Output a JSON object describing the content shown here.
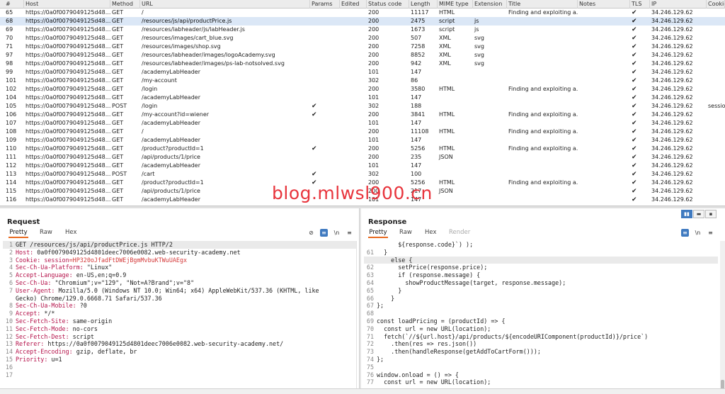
{
  "history": {
    "columns": {
      "num": "#",
      "host": "Host",
      "method": "Method",
      "url": "URL",
      "params": "Params",
      "edited": "Edited",
      "status": "Status code",
      "length": "Length",
      "mime": "MIME type",
      "ext": "Extension",
      "title": "Title",
      "notes": "Notes",
      "tls": "TLS",
      "ip": "IP",
      "cookie": "Cookie"
    },
    "selected_row": 1,
    "check_glyph": "✔",
    "rows": [
      {
        "num": "65",
        "host": "https://0a0f0079049125d48...",
        "method": "GET",
        "url": "/",
        "params": "",
        "edited": "",
        "status": "200",
        "length": "11117",
        "mime": "HTML",
        "ext": "",
        "title": "Finding and exploiting a...",
        "notes": "",
        "tls": "✔",
        "ip": "34.246.129.62",
        "cookie": ""
      },
      {
        "num": "68",
        "host": "https://0a0f0079049125d48...",
        "method": "GET",
        "url": "/resources/js/api/productPrice.js",
        "params": "",
        "edited": "",
        "status": "200",
        "length": "2475",
        "mime": "script",
        "ext": "js",
        "title": "",
        "notes": "",
        "tls": "✔",
        "ip": "34.246.129.62",
        "cookie": ""
      },
      {
        "num": "69",
        "host": "https://0a0f0079049125d48...",
        "method": "GET",
        "url": "/resources/labheader/js/labHeader.js",
        "params": "",
        "edited": "",
        "status": "200",
        "length": "1673",
        "mime": "script",
        "ext": "js",
        "title": "",
        "notes": "",
        "tls": "✔",
        "ip": "34.246.129.62",
        "cookie": ""
      },
      {
        "num": "70",
        "host": "https://0a0f0079049125d48...",
        "method": "GET",
        "url": "/resources/images/cart_blue.svg",
        "params": "",
        "edited": "",
        "status": "200",
        "length": "507",
        "mime": "XML",
        "ext": "svg",
        "title": "",
        "notes": "",
        "tls": "✔",
        "ip": "34.246.129.62",
        "cookie": ""
      },
      {
        "num": "71",
        "host": "https://0a0f0079049125d48...",
        "method": "GET",
        "url": "/resources/images/shop.svg",
        "params": "",
        "edited": "",
        "status": "200",
        "length": "7258",
        "mime": "XML",
        "ext": "svg",
        "title": "",
        "notes": "",
        "tls": "✔",
        "ip": "34.246.129.62",
        "cookie": ""
      },
      {
        "num": "97",
        "host": "https://0a0f0079049125d48...",
        "method": "GET",
        "url": "/resources/labheader/images/logoAcademy.svg",
        "params": "",
        "edited": "",
        "status": "200",
        "length": "8852",
        "mime": "XML",
        "ext": "svg",
        "title": "",
        "notes": "",
        "tls": "✔",
        "ip": "34.246.129.62",
        "cookie": ""
      },
      {
        "num": "98",
        "host": "https://0a0f0079049125d48...",
        "method": "GET",
        "url": "/resources/labheader/images/ps-lab-notsolved.svg",
        "params": "",
        "edited": "",
        "status": "200",
        "length": "942",
        "mime": "XML",
        "ext": "svg",
        "title": "",
        "notes": "",
        "tls": "✔",
        "ip": "34.246.129.62",
        "cookie": ""
      },
      {
        "num": "99",
        "host": "https://0a0f0079049125d48...",
        "method": "GET",
        "url": "/academyLabHeader",
        "params": "",
        "edited": "",
        "status": "101",
        "length": "147",
        "mime": "",
        "ext": "",
        "title": "",
        "notes": "",
        "tls": "✔",
        "ip": "34.246.129.62",
        "cookie": ""
      },
      {
        "num": "101",
        "host": "https://0a0f0079049125d48...",
        "method": "GET",
        "url": "/my-account",
        "params": "",
        "edited": "",
        "status": "302",
        "length": "86",
        "mime": "",
        "ext": "",
        "title": "",
        "notes": "",
        "tls": "✔",
        "ip": "34.246.129.62",
        "cookie": ""
      },
      {
        "num": "102",
        "host": "https://0a0f0079049125d48...",
        "method": "GET",
        "url": "/login",
        "params": "",
        "edited": "",
        "status": "200",
        "length": "3580",
        "mime": "HTML",
        "ext": "",
        "title": "Finding and exploiting a...",
        "notes": "",
        "tls": "✔",
        "ip": "34.246.129.62",
        "cookie": ""
      },
      {
        "num": "104",
        "host": "https://0a0f0079049125d48...",
        "method": "GET",
        "url": "/academyLabHeader",
        "params": "",
        "edited": "",
        "status": "101",
        "length": "147",
        "mime": "",
        "ext": "",
        "title": "",
        "notes": "",
        "tls": "✔",
        "ip": "34.246.129.62",
        "cookie": ""
      },
      {
        "num": "105",
        "host": "https://0a0f0079049125d48...",
        "method": "POST",
        "url": "/login",
        "params": "✔",
        "edited": "",
        "status": "302",
        "length": "188",
        "mime": "",
        "ext": "",
        "title": "",
        "notes": "",
        "tls": "✔",
        "ip": "34.246.129.62",
        "cookie": "sessio"
      },
      {
        "num": "106",
        "host": "https://0a0f0079049125d48...",
        "method": "GET",
        "url": "/my-account?id=wiener",
        "params": "✔",
        "edited": "",
        "status": "200",
        "length": "3841",
        "mime": "HTML",
        "ext": "",
        "title": "Finding and exploiting a...",
        "notes": "",
        "tls": "✔",
        "ip": "34.246.129.62",
        "cookie": ""
      },
      {
        "num": "107",
        "host": "https://0a0f0079049125d48...",
        "method": "GET",
        "url": "/academyLabHeader",
        "params": "",
        "edited": "",
        "status": "101",
        "length": "147",
        "mime": "",
        "ext": "",
        "title": "",
        "notes": "",
        "tls": "✔",
        "ip": "34.246.129.62",
        "cookie": ""
      },
      {
        "num": "108",
        "host": "https://0a0f0079049125d48...",
        "method": "GET",
        "url": "/",
        "params": "",
        "edited": "",
        "status": "200",
        "length": "11108",
        "mime": "HTML",
        "ext": "",
        "title": "Finding and exploiting a...",
        "notes": "",
        "tls": "✔",
        "ip": "34.246.129.62",
        "cookie": ""
      },
      {
        "num": "109",
        "host": "https://0a0f0079049125d48...",
        "method": "GET",
        "url": "/academyLabHeader",
        "params": "",
        "edited": "",
        "status": "101",
        "length": "147",
        "mime": "",
        "ext": "",
        "title": "",
        "notes": "",
        "tls": "✔",
        "ip": "34.246.129.62",
        "cookie": ""
      },
      {
        "num": "110",
        "host": "https://0a0f0079049125d48...",
        "method": "GET",
        "url": "/product?productId=1",
        "params": "✔",
        "edited": "",
        "status": "200",
        "length": "5256",
        "mime": "HTML",
        "ext": "",
        "title": "Finding and exploiting a...",
        "notes": "",
        "tls": "✔",
        "ip": "34.246.129.62",
        "cookie": ""
      },
      {
        "num": "111",
        "host": "https://0a0f0079049125d48...",
        "method": "GET",
        "url": "/api/products/1/price",
        "params": "",
        "edited": "",
        "status": "200",
        "length": "235",
        "mime": "JSON",
        "ext": "",
        "title": "",
        "notes": "",
        "tls": "✔",
        "ip": "34.246.129.62",
        "cookie": ""
      },
      {
        "num": "112",
        "host": "https://0a0f0079049125d48...",
        "method": "GET",
        "url": "/academyLabHeader",
        "params": "",
        "edited": "",
        "status": "101",
        "length": "147",
        "mime": "",
        "ext": "",
        "title": "",
        "notes": "",
        "tls": "✔",
        "ip": "34.246.129.62",
        "cookie": ""
      },
      {
        "num": "113",
        "host": "https://0a0f0079049125d48...",
        "method": "POST",
        "url": "/cart",
        "params": "✔",
        "edited": "",
        "status": "302",
        "length": "100",
        "mime": "",
        "ext": "",
        "title": "",
        "notes": "",
        "tls": "✔",
        "ip": "34.246.129.62",
        "cookie": ""
      },
      {
        "num": "114",
        "host": "https://0a0f0079049125d48...",
        "method": "GET",
        "url": "/product?productId=1",
        "params": "✔",
        "edited": "",
        "status": "200",
        "length": "5256",
        "mime": "HTML",
        "ext": "",
        "title": "Finding and exploiting a...",
        "notes": "",
        "tls": "✔",
        "ip": "34.246.129.62",
        "cookie": ""
      },
      {
        "num": "115",
        "host": "https://0a0f0079049125d48...",
        "method": "GET",
        "url": "/api/products/1/price",
        "params": "",
        "edited": "",
        "status": "200",
        "length": "217",
        "mime": "JSON",
        "ext": "",
        "title": "",
        "notes": "",
        "tls": "✔",
        "ip": "34.246.129.62",
        "cookie": ""
      },
      {
        "num": "116",
        "host": "https://0a0f0079049125d48...",
        "method": "GET",
        "url": "/academyLabHeader",
        "params": "",
        "edited": "",
        "status": "101",
        "length": "147",
        "mime": "",
        "ext": "",
        "title": "",
        "notes": "",
        "tls": "✔",
        "ip": "34.246.129.62",
        "cookie": ""
      }
    ]
  },
  "watermark": "blog.mlwsl900.cn",
  "request": {
    "title": "Request",
    "tabs": [
      "Pretty",
      "Raw",
      "Hex"
    ],
    "active_tab": 0,
    "tools": {
      "eye_off": "⊘",
      "format": "≡",
      "newline": "\\n",
      "menu": "≡"
    },
    "lines": [
      {
        "n": "1",
        "key": "",
        "val": "GET /resources/js/api/productPrice.js HTTP/2"
      },
      {
        "n": "2",
        "key": "Host:",
        "val": " 0a0f0079049125d4801deec7006e0082.web-security-academy.net"
      },
      {
        "n": "3",
        "key": "Cookie:",
        "val": " ",
        "cookie_name": "session",
        "cookie_val": "=HP320oJfadFtDWEjBgmMvbuKTWuUAEgx"
      },
      {
        "n": "4",
        "key": "Sec-Ch-Ua-Platform:",
        "val": " \"Linux\""
      },
      {
        "n": "5",
        "key": "Accept-Language:",
        "val": " en-US,en;q=0.9"
      },
      {
        "n": "6",
        "key": "Sec-Ch-Ua:",
        "val": " \"Chromium\";v=\"129\", \"Not=A?Brand\";v=\"8\""
      },
      {
        "n": "7",
        "key": "User-Agent:",
        "val": " Mozilla/5.0 (Windows NT 10.0; Win64; x64) AppleWebKit/537.36 (KHTML, like"
      },
      {
        "n": "",
        "key": "",
        "val": "Gecko) Chrome/129.0.6668.71 Safari/537.36"
      },
      {
        "n": "8",
        "key": "Sec-Ch-Ua-Mobile:",
        "val": " ?0"
      },
      {
        "n": "9",
        "key": "Accept:",
        "val": " */*"
      },
      {
        "n": "10",
        "key": "Sec-Fetch-Site:",
        "val": " same-origin"
      },
      {
        "n": "11",
        "key": "Sec-Fetch-Mode:",
        "val": " no-cors"
      },
      {
        "n": "12",
        "key": "Sec-Fetch-Dest:",
        "val": " script"
      },
      {
        "n": "13",
        "key": "Referer:",
        "val": " https://0a0f0079049125d4801deec7006e0082.web-security-academy.net/"
      },
      {
        "n": "14",
        "key": "Accept-Encoding:",
        "val": " gzip, deflate, br"
      },
      {
        "n": "15",
        "key": "Priority:",
        "val": " u=1"
      },
      {
        "n": "16",
        "key": "",
        "val": ""
      },
      {
        "n": "17",
        "key": "",
        "val": ""
      }
    ]
  },
  "response": {
    "title": "Response",
    "tabs": [
      "Pretty",
      "Raw",
      "Hex",
      "Render"
    ],
    "active_tab": 0,
    "tools": {
      "format": "≡",
      "newline": "\\n",
      "menu": "≡"
    },
    "layout_toggle": [
      "▮▮",
      "▬",
      "▪"
    ],
    "lines": [
      {
        "n": "",
        "t": "      ${response.code}`) );"
      },
      {
        "n": "61",
        "t": "  }"
      },
      {
        "n": "",
        "t": "    else {",
        "hl": true
      },
      {
        "n": "62",
        "t": "      setPrice(response.price);"
      },
      {
        "n": "63",
        "t": "      if (response.message) {"
      },
      {
        "n": "64",
        "t": "        showProductMessage(target, response.message);"
      },
      {
        "n": "65",
        "t": "      }"
      },
      {
        "n": "66",
        "t": "    }"
      },
      {
        "n": "67",
        "t": "};"
      },
      {
        "n": "68",
        "t": ""
      },
      {
        "n": "69",
        "t": "const loadPricing = (productId) => {"
      },
      {
        "n": "70",
        "t": "  const url = new URL(location);"
      },
      {
        "n": "71",
        "t": "  fetch(`//${url.host}/api/products/${encodeURIComponent(productId)}/price`)"
      },
      {
        "n": "72",
        "t": "    .then(res => res.json())"
      },
      {
        "n": "73",
        "t": "    .then(handleResponse(getAddToCartForm()));"
      },
      {
        "n": "74",
        "t": "};"
      },
      {
        "n": "75",
        "t": ""
      },
      {
        "n": "76",
        "t": "window.onload = () => {"
      },
      {
        "n": "77",
        "t": "  const url = new URL(location);"
      }
    ]
  }
}
